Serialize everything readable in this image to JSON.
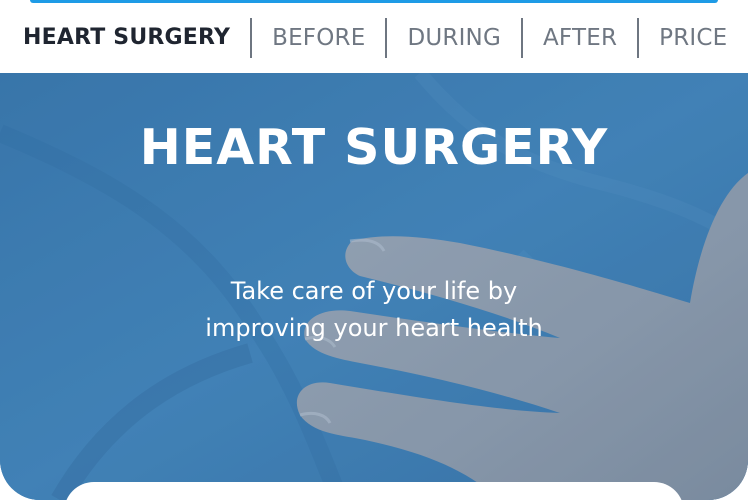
{
  "tabs": [
    {
      "label": "HEART SURGERY",
      "active": true
    },
    {
      "label": "BEFORE",
      "active": false
    },
    {
      "label": "DURING",
      "active": false
    },
    {
      "label": "AFTER",
      "active": false
    },
    {
      "label": "PRICE",
      "active": false
    }
  ],
  "hero": {
    "title": "HEART SURGERY",
    "subtitle": "Take care of your life by improving your heart health"
  },
  "colors": {
    "accent": "#1e9be6",
    "hero_overlay": "#3f7fb2",
    "tab_text": "#6f7782",
    "tab_active_text": "#1f2530"
  }
}
